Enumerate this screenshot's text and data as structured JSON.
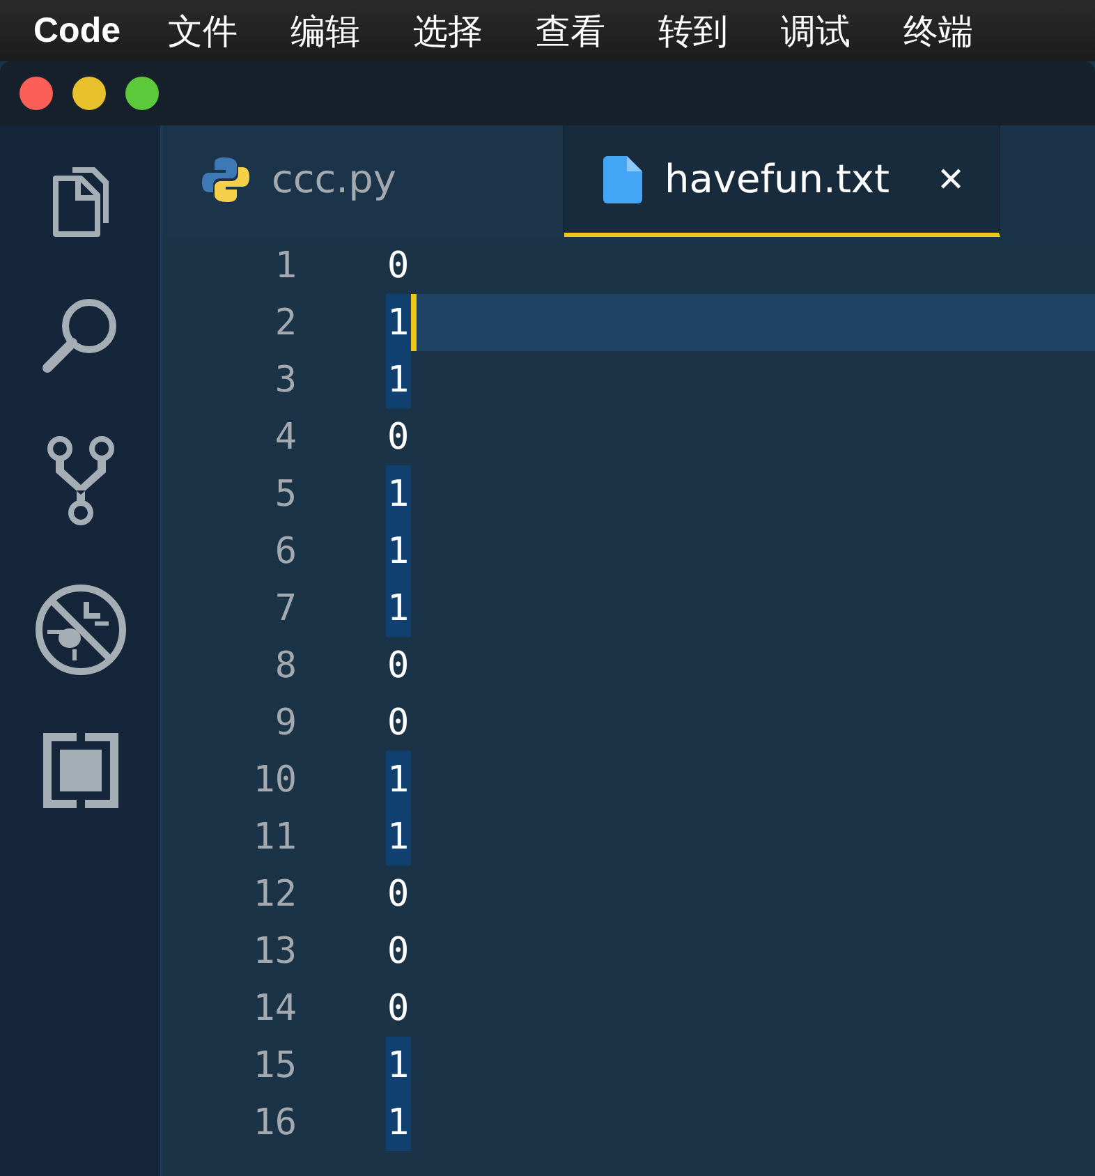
{
  "menu_bar": {
    "app_name": "Code",
    "items": [
      "文件",
      "编辑",
      "选择",
      "查看",
      "转到",
      "调试",
      "终端"
    ]
  },
  "activity_bar": {
    "items": [
      {
        "kind": "explorer"
      },
      {
        "kind": "search"
      },
      {
        "kind": "source_control"
      },
      {
        "kind": "debug"
      },
      {
        "kind": "extensions"
      }
    ]
  },
  "tabs": [
    {
      "label": "ccc.py",
      "kind": "python",
      "selected": false
    },
    {
      "label": "havefun.txt",
      "kind": "text",
      "selected": true,
      "close_symbol": "✕"
    }
  ],
  "editor": {
    "lines": [
      {
        "number": "1",
        "text": "0",
        "highlighted": false,
        "current": false
      },
      {
        "number": "2",
        "text": "1",
        "highlighted": true,
        "current": true
      },
      {
        "number": "3",
        "text": "1",
        "highlighted": true,
        "current": false
      },
      {
        "number": "4",
        "text": "0",
        "highlighted": false,
        "current": false
      },
      {
        "number": "5",
        "text": "1",
        "highlighted": true,
        "current": false
      },
      {
        "number": "6",
        "text": "1",
        "highlighted": true,
        "current": false
      },
      {
        "number": "7",
        "text": "1",
        "highlighted": true,
        "current": false
      },
      {
        "number": "8",
        "text": "0",
        "highlighted": false,
        "current": false
      },
      {
        "number": "9",
        "text": "0",
        "highlighted": false,
        "current": false
      },
      {
        "number": "10",
        "text": "1",
        "highlighted": true,
        "current": false
      },
      {
        "number": "11",
        "text": "1",
        "highlighted": true,
        "current": false
      },
      {
        "number": "12",
        "text": "0",
        "highlighted": false,
        "current": false
      },
      {
        "number": "13",
        "text": "0",
        "highlighted": false,
        "current": false
      },
      {
        "number": "14",
        "text": "0",
        "highlighted": false,
        "current": false
      },
      {
        "number": "15",
        "text": "1",
        "highlighted": true,
        "current": false
      },
      {
        "number": "16",
        "text": "1",
        "highlighted": true,
        "current": false
      }
    ]
  }
}
